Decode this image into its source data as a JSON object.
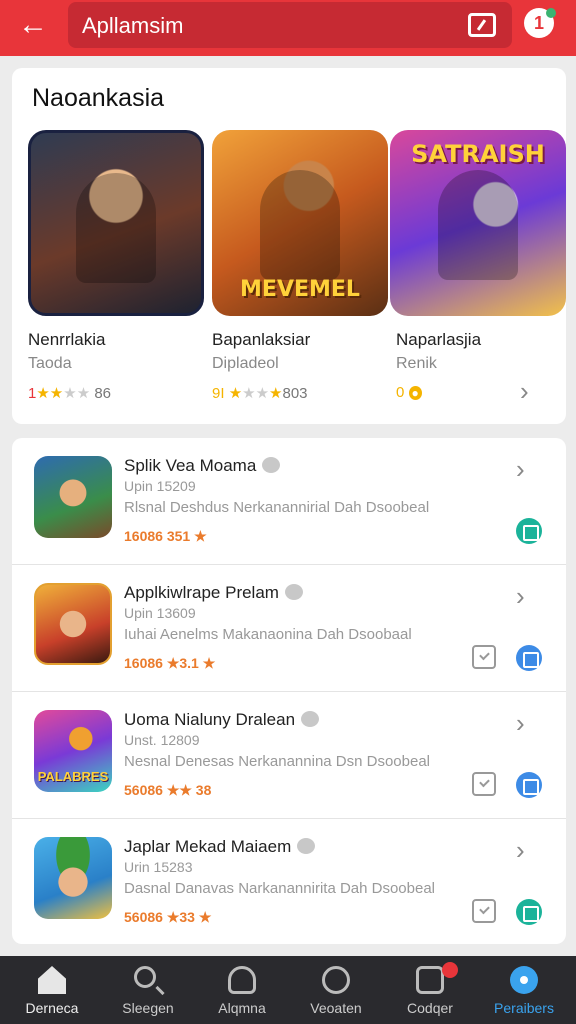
{
  "header": {
    "back_icon": "arrow-left-icon",
    "search_text": "Apllamsim",
    "right_icon": "tablet-icon",
    "notification_count": "1",
    "colors": {
      "bar": "#e8353a",
      "search": "#c62a33"
    }
  },
  "featured": {
    "title": "Naoankasia",
    "apps": [
      {
        "name": "Nenrrlakia",
        "subtitle": "Taoda",
        "rating_count": "86",
        "art_label": ""
      },
      {
        "name": "Bapanlaksiar",
        "subtitle": "Dipladeol",
        "rating_count": "9I",
        "rating_extra": "803",
        "art_label": "MEVEMEL"
      },
      {
        "name": "Naparlasjia",
        "subtitle": "Renik",
        "rating_count": "0",
        "art_label": "SATRAISH"
      }
    ]
  },
  "list": {
    "items": [
      {
        "title": "Splik Vea Moama",
        "version": "Upin  15209",
        "description": "Rlsnal Deshdus Nerkanannirial Dah Dsoobeal",
        "stats": "16086 351 ★"
      },
      {
        "title": "Applkiwlrape Prelam",
        "version": "Upin  13609",
        "description": "Iuhai Aenelms Makanaonina Dah Dsoobaal",
        "stats": "16086 ★3.1 ★"
      },
      {
        "title": "Uoma Nialuny Dralean",
        "version": "Unst.  12809",
        "description": "Nesnal Denesas Nerkanannina Dsn Dsoobeal",
        "stats": "56086 ★★  38",
        "icon_label": "PALABRES"
      },
      {
        "title": "Japlar Mekad Maiaem",
        "version": "Urin  15283",
        "description": "Dasnal Danavas Narkanannirita Dah Dsoobeal",
        "stats": "56086 ★33 ★"
      }
    ]
  },
  "bottom_nav": {
    "items": [
      {
        "label": "Derneca",
        "icon": "home-icon"
      },
      {
        "label": "Sleegen",
        "icon": "search-icon"
      },
      {
        "label": "Alqmna",
        "icon": "user-icon"
      },
      {
        "label": "Veoaten",
        "icon": "face-icon"
      },
      {
        "label": "Codqer",
        "icon": "box-icon"
      },
      {
        "label": "Peraibers",
        "icon": "circle-icon"
      }
    ],
    "active_color": "#3aa3ee"
  }
}
